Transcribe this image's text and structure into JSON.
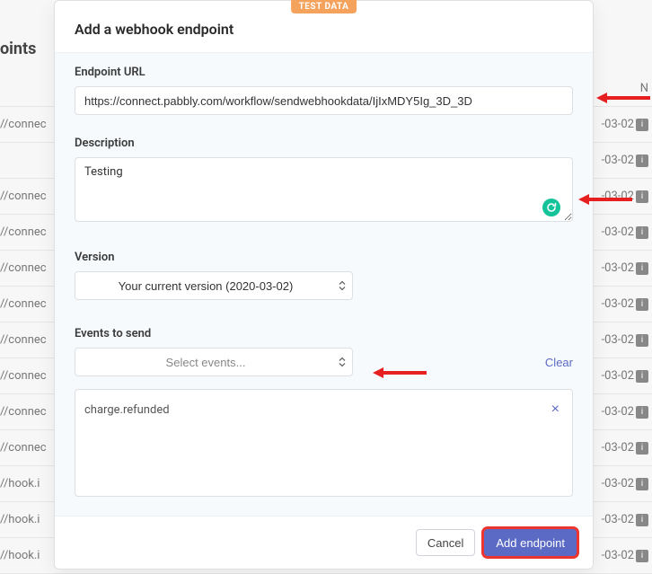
{
  "bg": {
    "title": "oints",
    "left_text": "//connec",
    "left_text_alt": "//hook.i",
    "date": "-03-02",
    "header_right": "N"
  },
  "modal": {
    "badge": "TEST DATA",
    "title": "Add a webhook endpoint",
    "endpoint_label": "Endpoint URL",
    "endpoint_value": "https://connect.pabbly.com/workflow/sendwebhookdata/IjIxMDY5Ig_3D_3D",
    "description_label": "Description",
    "description_value": "Testing",
    "version_label": "Version",
    "version_value": "Your current version (2020-03-02)",
    "events_label": "Events to send",
    "events_placeholder": "Select events...",
    "clear": "Clear",
    "selected_event": "charge.refunded",
    "cancel": "Cancel",
    "submit": "Add endpoint"
  }
}
